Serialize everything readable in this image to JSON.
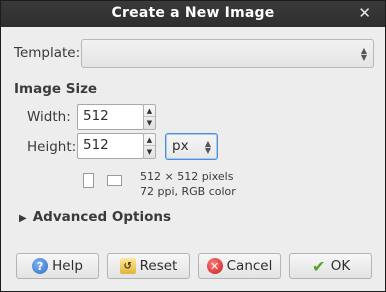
{
  "window": {
    "title": "Create a New Image"
  },
  "template": {
    "label": "Template:",
    "value": ""
  },
  "image_size": {
    "heading": "Image Size",
    "width_label": "Width:",
    "width_value": "512",
    "height_label": "Height:",
    "height_value": "512",
    "unit": "px",
    "info_line1": "512 × 512 pixels",
    "info_line2": "72 ppi, RGB color"
  },
  "advanced": {
    "label": "Advanced Options"
  },
  "buttons": {
    "help": "Help",
    "reset": "Reset",
    "cancel": "Cancel",
    "ok": "OK"
  },
  "icons": {
    "close": "✕",
    "expander_arrow": "▶"
  }
}
